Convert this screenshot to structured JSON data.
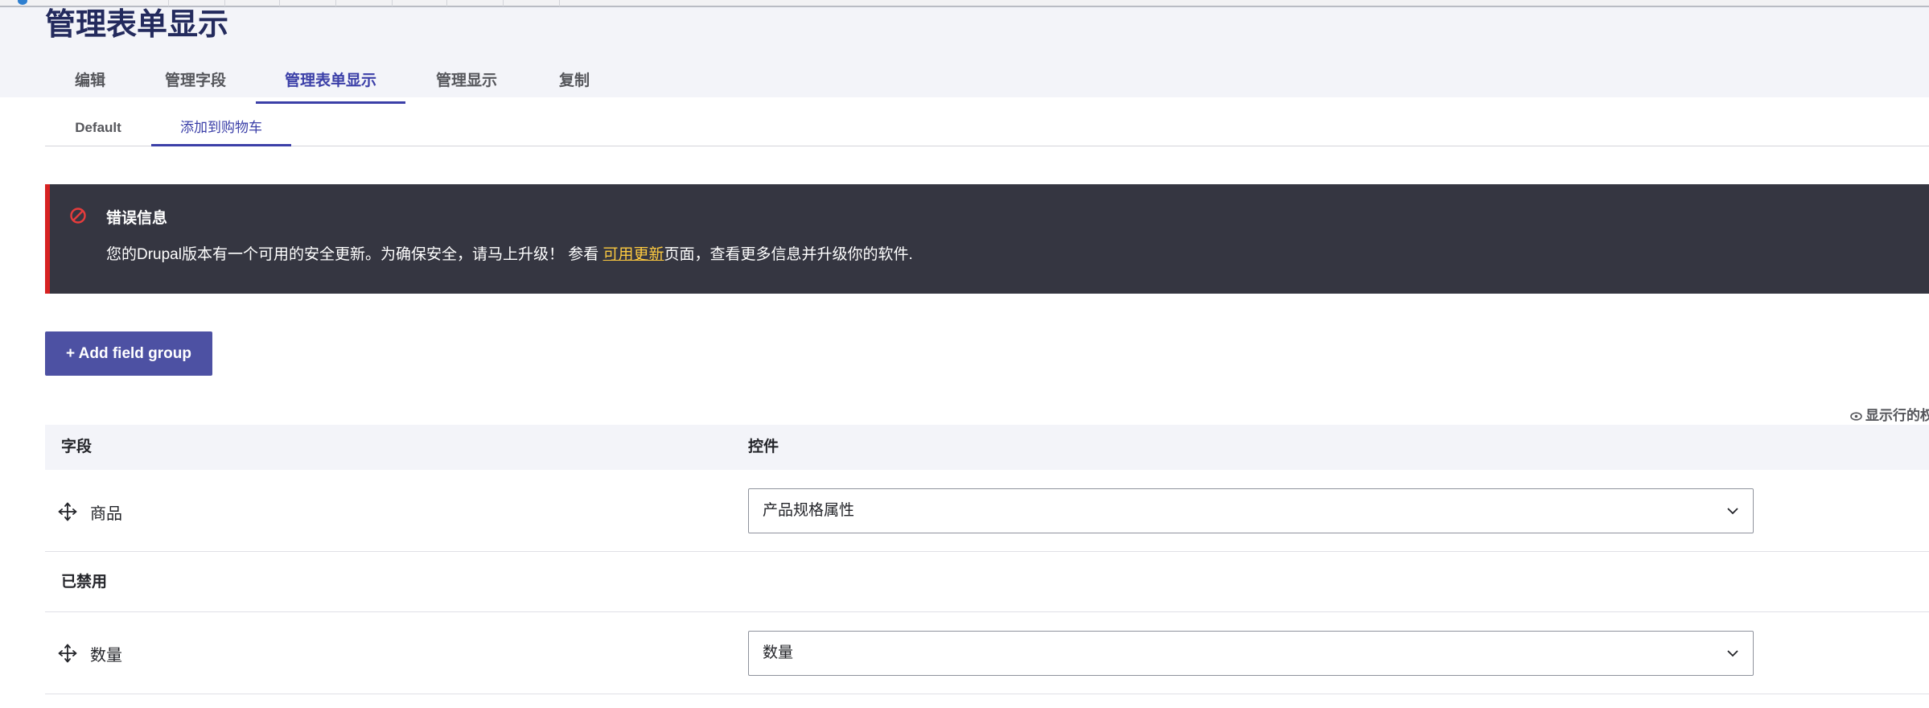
{
  "page": {
    "title": "管理表单显示"
  },
  "primary_tabs": [
    {
      "label": "编辑"
    },
    {
      "label": "管理字段"
    },
    {
      "label": "管理表单显示"
    },
    {
      "label": "管理显示"
    },
    {
      "label": "复制"
    }
  ],
  "secondary_tabs": [
    {
      "label": "Default"
    },
    {
      "label": "添加到购物车"
    }
  ],
  "active_primary_tab": "管理表单显示",
  "active_secondary_tab": "添加到购物车",
  "message": {
    "type": "error",
    "icon": "error-circle-icon",
    "title": "错误信息",
    "text_before": "您的Drupal版本有一个可用的安全更新。为确保安全，请马上升级！ 参看 ",
    "link_text": "可用更新",
    "text_after": "页面，查看更多信息并升级你的软件."
  },
  "actions": {
    "add_field_group": "+ Add field group",
    "show_row_weights": "显示行的权"
  },
  "table": {
    "headers": {
      "field": "字段",
      "widget": "控件"
    },
    "rows": [
      {
        "kind": "field",
        "label": "商品",
        "widget": "产品规格属性"
      },
      {
        "kind": "region",
        "label": "已禁用"
      },
      {
        "kind": "field",
        "label": "数量",
        "widget": "数量"
      }
    ]
  },
  "colors": {
    "accent": "#3b3fa8",
    "button": "#4d51a3",
    "title": "#232a5d",
    "message_bg": "#353641",
    "message_border": "#d72222",
    "link": "#fdca40",
    "header_bg": "#f3f4f9"
  }
}
